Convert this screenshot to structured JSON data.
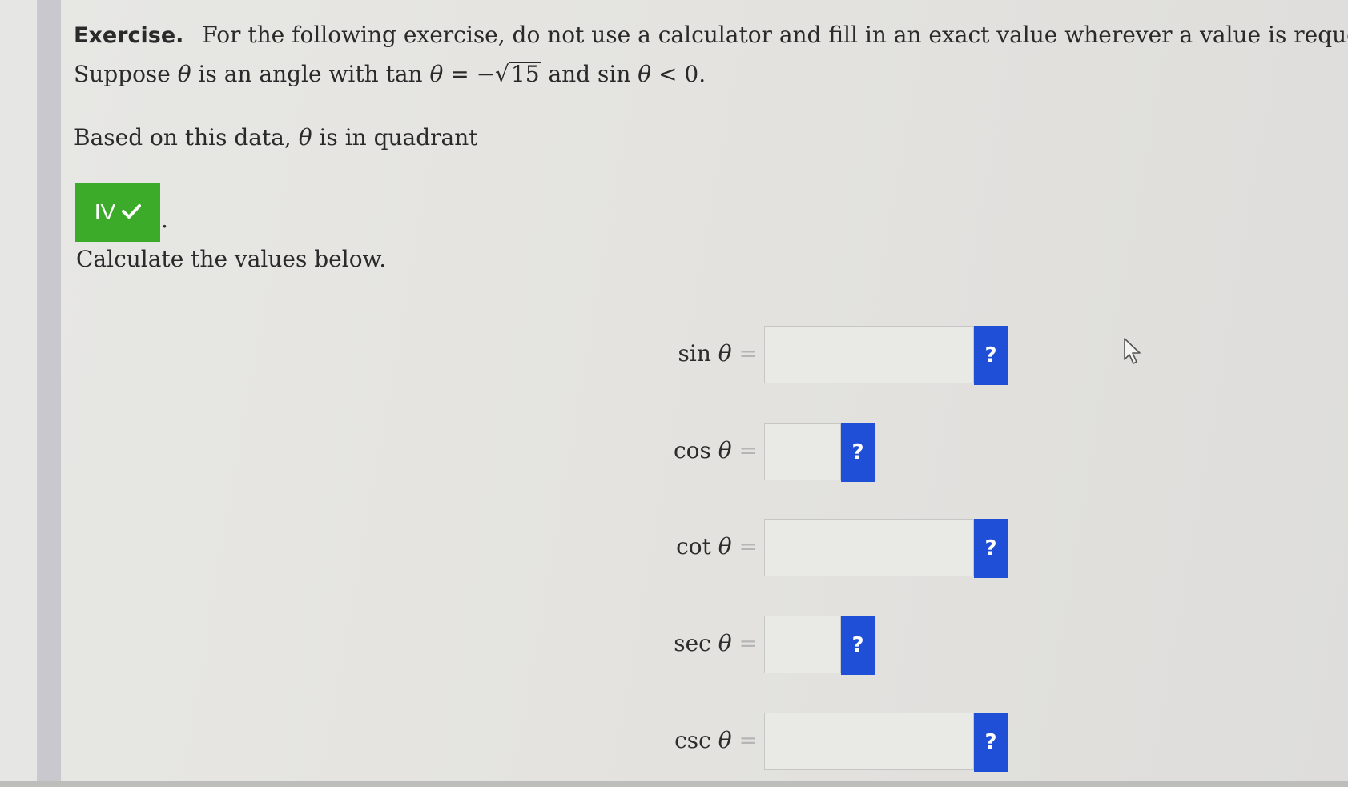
{
  "exercise": {
    "label": "Exercise.",
    "instruction": "For the following exercise, do not use a calculator and fill in an exact value wherever a value is requested.",
    "suppose_text": "Suppose",
    "theta": "θ",
    "angle_text": "is an angle with tan",
    "equals_neg": "= −",
    "sqrt_value": "15",
    "and_sin": "and sin",
    "less_zero": "< 0."
  },
  "quadrant": {
    "prompt_start": "Based on this data,",
    "prompt_end": "is in quadrant",
    "answer": "IV",
    "check_icon": "check-icon",
    "answer_color": "#3cab2a",
    "period": "."
  },
  "calculate": {
    "heading": "Calculate the values below."
  },
  "fields": [
    {
      "label": "sin",
      "help": "?"
    },
    {
      "label": "cos",
      "help": "?"
    },
    {
      "label": "cot",
      "help": "?"
    },
    {
      "label": "sec",
      "help": "?"
    },
    {
      "label": "csc",
      "help": "?"
    }
  ],
  "help_button_color": "#1f4fd6",
  "theta_symbol": "θ",
  "equals_symbol": "="
}
